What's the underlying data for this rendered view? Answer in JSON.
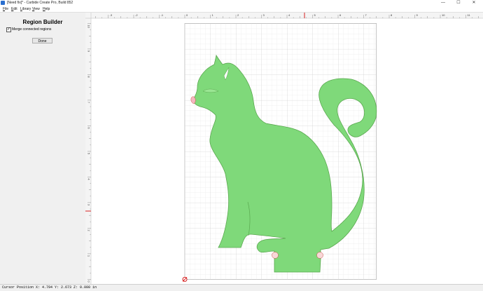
{
  "window": {
    "title": "[Need fix]* - Carbide Create Pro, Build 852",
    "minimize_glyph": "—",
    "maximize_glyph": "☐",
    "close_glyph": "✕"
  },
  "menu": {
    "items": [
      "File",
      "Edit",
      "Library",
      "View",
      "Help"
    ]
  },
  "sidebar": {
    "title": "Region Builder",
    "merge_label": "Merge connected regions",
    "merge_checked": true,
    "done_label": "Done"
  },
  "ruler": {
    "x_labels": [
      "-3",
      "-2",
      "-1",
      "0",
      "1",
      "2",
      "3",
      "4",
      "5",
      "6",
      "7",
      "8",
      "9",
      "10",
      "11"
    ],
    "y_labels": [
      "10",
      "9",
      "8",
      "7",
      "6",
      "5",
      "4",
      "3",
      "2",
      "1",
      "0"
    ]
  },
  "status": {
    "text": "Cursor Position X: 4.794 Y: 2.673 Z: 0.000 in"
  },
  "colors": {
    "shape_fill": "#7fd97a",
    "shape_stroke": "#5aa84f",
    "stock": "#ffffff",
    "cursor_marker": "#d61f1f"
  },
  "icons": {
    "app": "carbide-create-app-icon",
    "origin": "origin-marker-icon"
  }
}
